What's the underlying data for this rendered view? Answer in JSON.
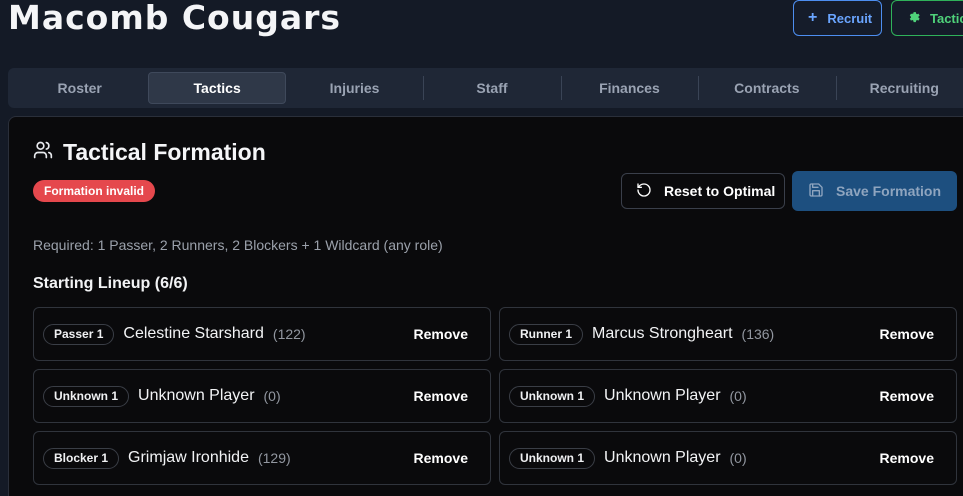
{
  "header": {
    "team_name": "Macomb Cougars",
    "recruit_label": "Recruit",
    "tactics_label": "Tactics"
  },
  "tabs": [
    {
      "label": "Roster"
    },
    {
      "label": "Tactics",
      "active": true
    },
    {
      "label": "Injuries"
    },
    {
      "label": "Staff"
    },
    {
      "label": "Finances"
    },
    {
      "label": "Contracts"
    },
    {
      "label": "Recruiting"
    }
  ],
  "formation": {
    "title": "Tactical Formation",
    "status_badge": "Formation invalid",
    "reset_label": "Reset to Optimal",
    "save_label": "Save Formation",
    "requirement": "Required: 1 Passer, 2 Runners, 2 Blockers + 1 Wildcard (any role)",
    "lineup_title": "Starting Lineup (6/6)",
    "slots": [
      {
        "role": "Passer 1",
        "name": "Celestine Starshard",
        "rating": "(122)",
        "action": "Remove"
      },
      {
        "role": "Runner 1",
        "name": "Marcus Strongheart",
        "rating": "(136)",
        "action": "Remove"
      },
      {
        "role": "Unknown 1",
        "name": "Unknown Player",
        "rating": "(0)",
        "action": "Remove"
      },
      {
        "role": "Unknown 1",
        "name": "Unknown Player",
        "rating": "(0)",
        "action": "Remove"
      },
      {
        "role": "Blocker 1",
        "name": "Grimjaw Ironhide",
        "rating": "(129)",
        "action": "Remove"
      },
      {
        "role": "Unknown 1",
        "name": "Unknown Player",
        "rating": "(0)",
        "action": "Remove"
      }
    ]
  },
  "colors": {
    "accent_blue": "#4d8ef0",
    "accent_green": "#2fb25a",
    "invalid_red": "#e5484d",
    "save_blue": "#1d4f7f"
  },
  "icons": {
    "recruit": "plus-icon",
    "tactics": "gear-icon",
    "title": "users-icon",
    "reset": "rotate-ccw-icon",
    "save": "save-icon"
  }
}
